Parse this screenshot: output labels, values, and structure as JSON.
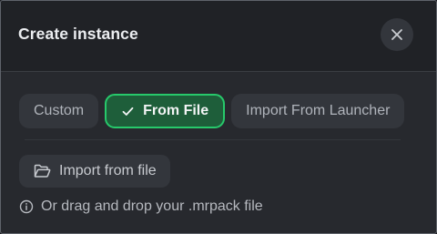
{
  "dialog": {
    "title": "Create instance",
    "close_icon": "close-icon"
  },
  "tabs": [
    {
      "label": "Custom",
      "active": false
    },
    {
      "label": "From File",
      "active": true,
      "icon": "check-icon"
    },
    {
      "label": "Import From Launcher",
      "active": false
    }
  ],
  "import_button": {
    "label": "Import from file",
    "icon": "folder-open-icon"
  },
  "hint": {
    "text": "Or drag and drop your .mrpack file",
    "icon": "info-icon"
  },
  "colors": {
    "active_tab_bg": "#1e5e3a",
    "active_tab_border": "#27c96b",
    "surface": "#27292e",
    "header": "#202226",
    "button": "#33363c"
  }
}
